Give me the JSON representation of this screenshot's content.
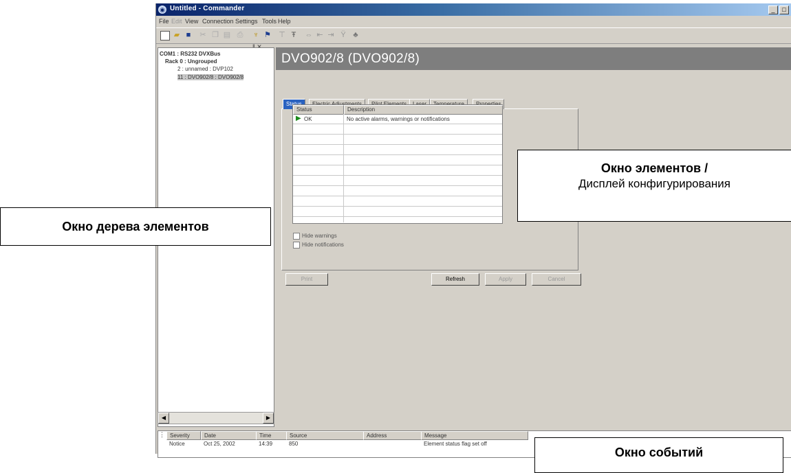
{
  "window": {
    "title": "Untitled - Commander",
    "buttons": [
      "_",
      "□",
      "×"
    ]
  },
  "menu": [
    "File",
    "Edit",
    "View",
    "Connection",
    "Settings",
    "Tools",
    "Help"
  ],
  "toolbar_icons": [
    "new-icon",
    "open-icon",
    "save-icon",
    "cut-icon",
    "copy-icon",
    "paste-icon",
    "print-icon",
    "probe-icon",
    "connect-icon",
    "filter-icon",
    "filter-add-icon",
    "swap-icon",
    "left-icon",
    "right-icon",
    "signal-icon",
    "network-icon"
  ],
  "tree": {
    "header": "ǁ ✕",
    "items": [
      {
        "label": "COM1 : RS232 DVXBus",
        "indent": 0,
        "bold": true
      },
      {
        "label": "Rack 0 : Ungrouped",
        "indent": 1,
        "bold": true
      },
      {
        "label": "2 : unnamed : DVP102",
        "indent": 2,
        "bold": false
      },
      {
        "label": "11 : DVO902/8 : DVO902/8",
        "indent": 2,
        "bold": false,
        "selected": true
      }
    ]
  },
  "panel": {
    "header": "DVO902/8 (DVO902/8)",
    "tabs": [
      "Status",
      "Electric Adjustments",
      "Pilot Elements",
      "Laser",
      "Temperature",
      "Properties"
    ],
    "active_tab": "Status",
    "table": {
      "columns": [
        "Status",
        "Description"
      ],
      "rows": [
        {
          "status": "OK",
          "description": "No active alarms, warnings or notifications"
        }
      ]
    },
    "checkboxes": [
      "Hide warnings",
      "Hide notifications"
    ],
    "buttons": {
      "print": "Print",
      "refresh": "Refresh",
      "apply": "Apply",
      "cancel": "Cancel"
    }
  },
  "events": {
    "columns": [
      "Severity",
      "Date",
      "Time",
      "Source",
      "Address",
      "Message"
    ],
    "rows": [
      {
        "severity": "Notice",
        "date": "Oct 25, 2002",
        "time": "14:39",
        "source": "850",
        "address": "",
        "message": "Element status flag set off"
      }
    ]
  },
  "callouts": {
    "items_window_line1": "Окно элементов /",
    "items_window_line2": "Дисплей конфигурирования",
    "tree_window": "Окно дерева элементов",
    "events_window": "Окно событий"
  }
}
